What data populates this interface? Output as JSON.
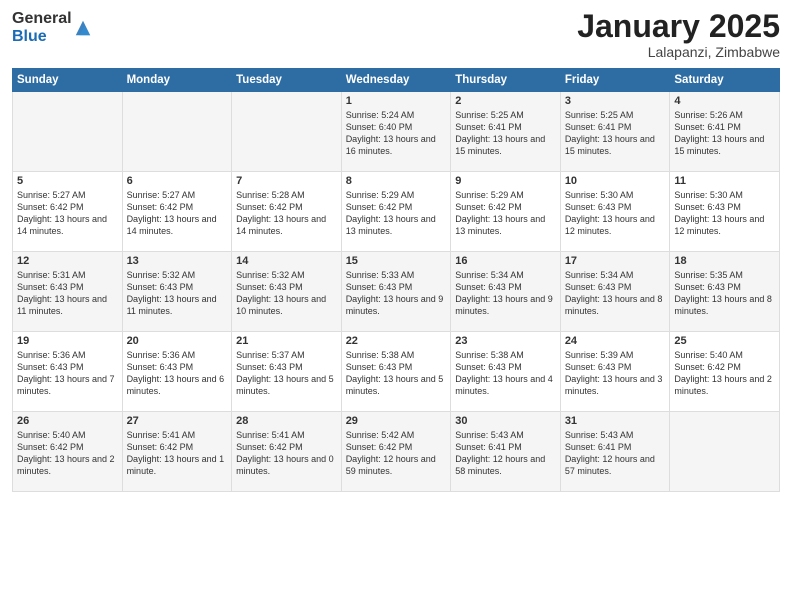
{
  "logo": {
    "general": "General",
    "blue": "Blue"
  },
  "title": "January 2025",
  "location": "Lalapanzi, Zimbabwe",
  "days_of_week": [
    "Sunday",
    "Monday",
    "Tuesday",
    "Wednesday",
    "Thursday",
    "Friday",
    "Saturday"
  ],
  "weeks": [
    [
      {
        "day": "",
        "info": ""
      },
      {
        "day": "",
        "info": ""
      },
      {
        "day": "",
        "info": ""
      },
      {
        "day": "1",
        "info": "Sunrise: 5:24 AM\nSunset: 6:40 PM\nDaylight: 13 hours and 16 minutes."
      },
      {
        "day": "2",
        "info": "Sunrise: 5:25 AM\nSunset: 6:41 PM\nDaylight: 13 hours and 15 minutes."
      },
      {
        "day": "3",
        "info": "Sunrise: 5:25 AM\nSunset: 6:41 PM\nDaylight: 13 hours and 15 minutes."
      },
      {
        "day": "4",
        "info": "Sunrise: 5:26 AM\nSunset: 6:41 PM\nDaylight: 13 hours and 15 minutes."
      }
    ],
    [
      {
        "day": "5",
        "info": "Sunrise: 5:27 AM\nSunset: 6:42 PM\nDaylight: 13 hours and 14 minutes."
      },
      {
        "day": "6",
        "info": "Sunrise: 5:27 AM\nSunset: 6:42 PM\nDaylight: 13 hours and 14 minutes."
      },
      {
        "day": "7",
        "info": "Sunrise: 5:28 AM\nSunset: 6:42 PM\nDaylight: 13 hours and 14 minutes."
      },
      {
        "day": "8",
        "info": "Sunrise: 5:29 AM\nSunset: 6:42 PM\nDaylight: 13 hours and 13 minutes."
      },
      {
        "day": "9",
        "info": "Sunrise: 5:29 AM\nSunset: 6:42 PM\nDaylight: 13 hours and 13 minutes."
      },
      {
        "day": "10",
        "info": "Sunrise: 5:30 AM\nSunset: 6:43 PM\nDaylight: 13 hours and 12 minutes."
      },
      {
        "day": "11",
        "info": "Sunrise: 5:30 AM\nSunset: 6:43 PM\nDaylight: 13 hours and 12 minutes."
      }
    ],
    [
      {
        "day": "12",
        "info": "Sunrise: 5:31 AM\nSunset: 6:43 PM\nDaylight: 13 hours and 11 minutes."
      },
      {
        "day": "13",
        "info": "Sunrise: 5:32 AM\nSunset: 6:43 PM\nDaylight: 13 hours and 11 minutes."
      },
      {
        "day": "14",
        "info": "Sunrise: 5:32 AM\nSunset: 6:43 PM\nDaylight: 13 hours and 10 minutes."
      },
      {
        "day": "15",
        "info": "Sunrise: 5:33 AM\nSunset: 6:43 PM\nDaylight: 13 hours and 9 minutes."
      },
      {
        "day": "16",
        "info": "Sunrise: 5:34 AM\nSunset: 6:43 PM\nDaylight: 13 hours and 9 minutes."
      },
      {
        "day": "17",
        "info": "Sunrise: 5:34 AM\nSunset: 6:43 PM\nDaylight: 13 hours and 8 minutes."
      },
      {
        "day": "18",
        "info": "Sunrise: 5:35 AM\nSunset: 6:43 PM\nDaylight: 13 hours and 8 minutes."
      }
    ],
    [
      {
        "day": "19",
        "info": "Sunrise: 5:36 AM\nSunset: 6:43 PM\nDaylight: 13 hours and 7 minutes."
      },
      {
        "day": "20",
        "info": "Sunrise: 5:36 AM\nSunset: 6:43 PM\nDaylight: 13 hours and 6 minutes."
      },
      {
        "day": "21",
        "info": "Sunrise: 5:37 AM\nSunset: 6:43 PM\nDaylight: 13 hours and 5 minutes."
      },
      {
        "day": "22",
        "info": "Sunrise: 5:38 AM\nSunset: 6:43 PM\nDaylight: 13 hours and 5 minutes."
      },
      {
        "day": "23",
        "info": "Sunrise: 5:38 AM\nSunset: 6:43 PM\nDaylight: 13 hours and 4 minutes."
      },
      {
        "day": "24",
        "info": "Sunrise: 5:39 AM\nSunset: 6:43 PM\nDaylight: 13 hours and 3 minutes."
      },
      {
        "day": "25",
        "info": "Sunrise: 5:40 AM\nSunset: 6:42 PM\nDaylight: 13 hours and 2 minutes."
      }
    ],
    [
      {
        "day": "26",
        "info": "Sunrise: 5:40 AM\nSunset: 6:42 PM\nDaylight: 13 hours and 2 minutes."
      },
      {
        "day": "27",
        "info": "Sunrise: 5:41 AM\nSunset: 6:42 PM\nDaylight: 13 hours and 1 minute."
      },
      {
        "day": "28",
        "info": "Sunrise: 5:41 AM\nSunset: 6:42 PM\nDaylight: 13 hours and 0 minutes."
      },
      {
        "day": "29",
        "info": "Sunrise: 5:42 AM\nSunset: 6:42 PM\nDaylight: 12 hours and 59 minutes."
      },
      {
        "day": "30",
        "info": "Sunrise: 5:43 AM\nSunset: 6:41 PM\nDaylight: 12 hours and 58 minutes."
      },
      {
        "day": "31",
        "info": "Sunrise: 5:43 AM\nSunset: 6:41 PM\nDaylight: 12 hours and 57 minutes."
      },
      {
        "day": "",
        "info": ""
      }
    ]
  ]
}
